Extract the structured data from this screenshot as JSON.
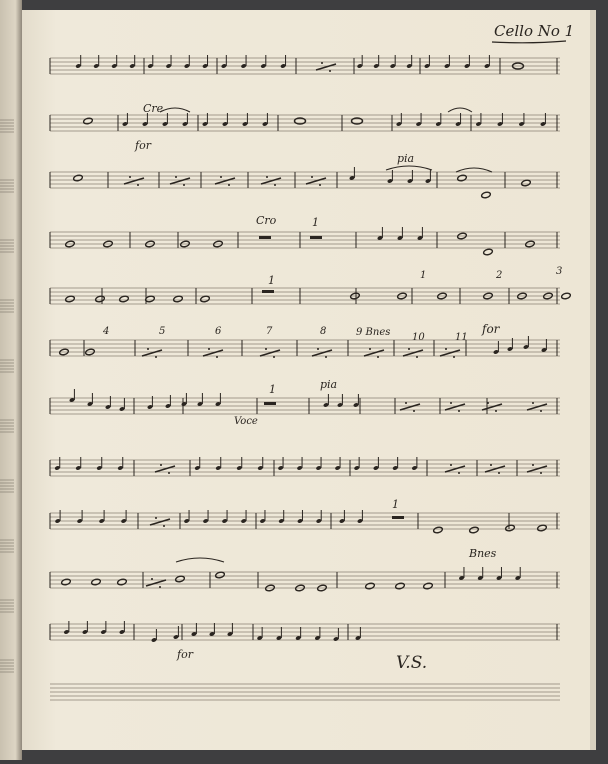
{
  "page": {
    "part_title": "Cello No 1",
    "closing_mark": "V.S."
  },
  "annotations": {
    "cresc_1": "Cre",
    "forte_1": "for",
    "piano_1": "pia",
    "cresc_2": "Cro",
    "rest_count_1": "1",
    "rest_count_2": "1",
    "rest_count_3": "1",
    "rest_count_4": "1",
    "cue_bones_1": "9 Bnes",
    "forte_2": "for",
    "piano_2": "pia",
    "cue_voice": "Voce",
    "cue_bones_2": "Bnes",
    "forte_3": "for",
    "bar_numbers": [
      "1",
      "2",
      "3",
      "4",
      "5",
      "6",
      "7",
      "8",
      "10",
      "11"
    ]
  },
  "colors": {
    "paper": "#efe8d8",
    "ink": "#2a2520",
    "staff_line": "#8a8073",
    "pencil_blue": "#2d5c9e"
  },
  "staves": [
    {
      "label": "staff-1"
    },
    {
      "label": "staff-2"
    },
    {
      "label": "staff-3"
    },
    {
      "label": "staff-4"
    },
    {
      "label": "staff-5"
    },
    {
      "label": "staff-6"
    },
    {
      "label": "staff-7"
    },
    {
      "label": "staff-8"
    },
    {
      "label": "staff-9"
    },
    {
      "label": "staff-10"
    },
    {
      "label": "staff-11"
    },
    {
      "label": "staff-12"
    }
  ]
}
